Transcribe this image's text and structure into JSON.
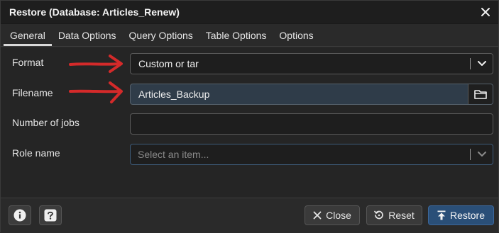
{
  "window": {
    "title": "Restore (Database: Articles_Renew)"
  },
  "tabs": [
    {
      "label": "General",
      "active": true
    },
    {
      "label": "Data Options",
      "active": false
    },
    {
      "label": "Query Options",
      "active": false
    },
    {
      "label": "Table Options",
      "active": false
    },
    {
      "label": "Options",
      "active": false
    }
  ],
  "form": {
    "format": {
      "label": "Format",
      "value": "Custom or tar"
    },
    "filename": {
      "label": "Filename",
      "value": "Articles_Backup"
    },
    "jobs": {
      "label": "Number of jobs",
      "value": ""
    },
    "role": {
      "label": "Role name",
      "placeholder": "Select an item..."
    }
  },
  "footer": {
    "info_icon": "info-icon",
    "help_icon": "help-icon",
    "close_label": "Close",
    "reset_label": "Reset",
    "restore_label": "Restore"
  },
  "colors": {
    "annotation_arrow": "#d42a2a",
    "primary_button": "#2a4f78",
    "filename_field": "#2f3c49"
  }
}
